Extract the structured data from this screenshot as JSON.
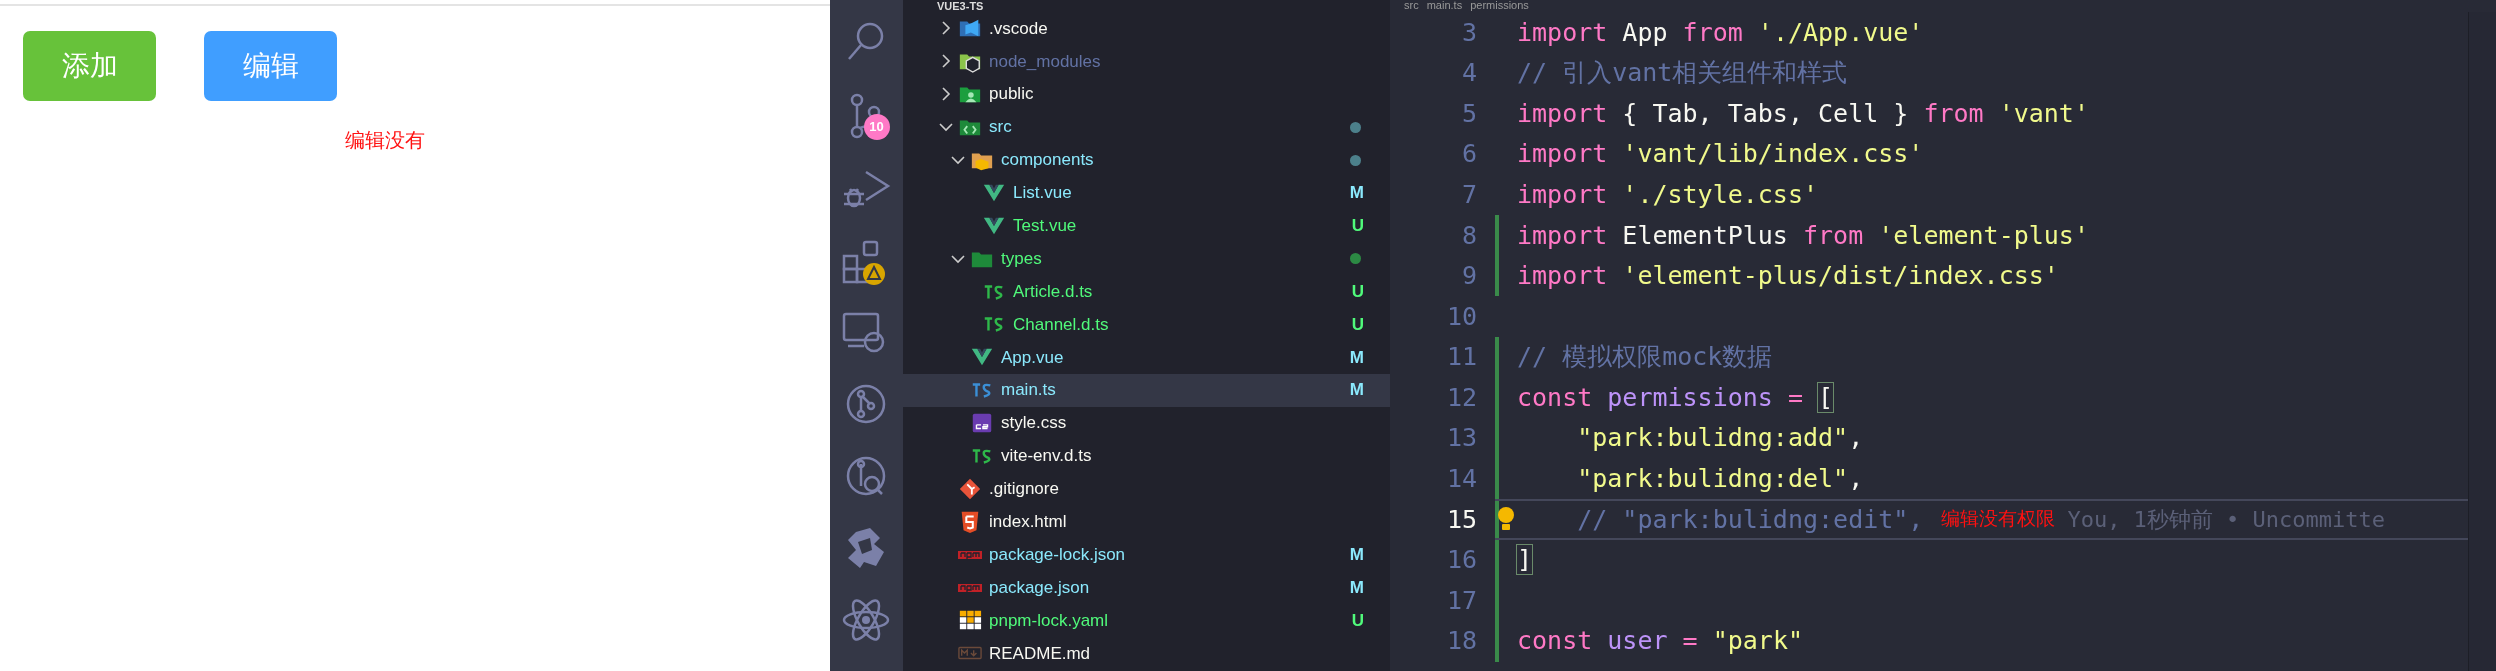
{
  "page": {
    "buttons": [
      {
        "label": "添加",
        "kind": "success"
      },
      {
        "label": "编辑",
        "kind": "primary"
      }
    ],
    "message": "编辑没有"
  },
  "activity_bar": {
    "source_control_badge": "10"
  },
  "explorer": {
    "title": "VUE3-TS",
    "tree": [
      {
        "name": ".vscode",
        "kind": "folder-vscode",
        "expanded": false,
        "color": "#f8f8f2",
        "dot": false,
        "selected": false
      },
      {
        "name": "node_modules",
        "kind": "folder-node",
        "expanded": false,
        "color": "#6272a4",
        "dot": false,
        "selected": false
      },
      {
        "name": "public",
        "kind": "folder-public",
        "expanded": false,
        "color": "#f8f8f2",
        "dot": false,
        "selected": false
      },
      {
        "name": "src",
        "kind": "folder-src",
        "expanded": true,
        "color": "#8be9fd",
        "dot": true,
        "selected": false,
        "children": [
          {
            "name": "components",
            "kind": "folder-components",
            "expanded": true,
            "color": "#8be9fd",
            "dot": true,
            "selected": false,
            "children": [
              {
                "name": "List.vue",
                "kind": "vue",
                "color": "#8be9fd",
                "badge": "M",
                "selected": false
              },
              {
                "name": "Test.vue",
                "kind": "vue",
                "color": "#50fa7b",
                "badge": "U",
                "selected": false
              }
            ]
          },
          {
            "name": "types",
            "kind": "folder-types",
            "expanded": true,
            "color": "#50fa7b",
            "dot": true,
            "selected": false,
            "children": [
              {
                "name": "Article.d.ts",
                "kind": "ts-def",
                "color": "#50fa7b",
                "badge": "U",
                "selected": false
              },
              {
                "name": "Channel.d.ts",
                "kind": "ts-def",
                "color": "#50fa7b",
                "badge": "U",
                "selected": false
              }
            ]
          },
          {
            "name": "App.vue",
            "kind": "vue",
            "color": "#8be9fd",
            "badge": "M",
            "selected": false
          },
          {
            "name": "main.ts",
            "kind": "ts",
            "color": "#8be9fd",
            "badge": "M",
            "selected": true
          },
          {
            "name": "style.css",
            "kind": "css",
            "color": "#f8f8f2",
            "selected": false
          },
          {
            "name": "vite-env.d.ts",
            "kind": "ts-def",
            "color": "#f8f8f2",
            "selected": false
          }
        ]
      },
      {
        "name": ".gitignore",
        "kind": "git",
        "color": "#f8f8f2",
        "selected": false
      },
      {
        "name": "index.html",
        "kind": "html",
        "color": "#f8f8f2",
        "selected": false
      },
      {
        "name": "package-lock.json",
        "kind": "npm",
        "color": "#8be9fd",
        "badge": "M",
        "selected": false
      },
      {
        "name": "package.json",
        "kind": "npm",
        "color": "#8be9fd",
        "badge": "M",
        "selected": false
      },
      {
        "name": "pnpm-lock.yaml",
        "kind": "yaml",
        "color": "#50fa7b",
        "badge": "U",
        "selected": false
      },
      {
        "name": "README.md",
        "kind": "md",
        "color": "#f8f8f2",
        "selected": false
      }
    ]
  },
  "editor": {
    "breadcrumb": [
      "src",
      "main.ts",
      "permissions"
    ],
    "lines": [
      {
        "number": "3",
        "added": false,
        "current": false,
        "tokens": [
          {
            "t": "import ",
            "kind": "keyword"
          },
          {
            "t": "App ",
            "kind": "plain"
          },
          {
            "t": "from ",
            "kind": "keyword"
          },
          {
            "t": "'./App.vue'",
            "kind": "string"
          }
        ]
      },
      {
        "number": "4",
        "added": false,
        "current": false,
        "tokens": [
          {
            "t": "// 引入vant相关组件和样式",
            "kind": "comment"
          }
        ]
      },
      {
        "number": "5",
        "added": false,
        "current": false,
        "tokens": [
          {
            "t": "import ",
            "kind": "keyword"
          },
          {
            "t": "{ Tab, Tabs, Cell } ",
            "kind": "plain"
          },
          {
            "t": "from ",
            "kind": "keyword"
          },
          {
            "t": "'vant'",
            "kind": "string"
          }
        ]
      },
      {
        "number": "6",
        "added": false,
        "current": false,
        "tokens": [
          {
            "t": "import ",
            "kind": "keyword"
          },
          {
            "t": "'vant/lib/index.css'",
            "kind": "string"
          }
        ]
      },
      {
        "number": "7",
        "added": false,
        "current": false,
        "tokens": [
          {
            "t": "import ",
            "kind": "keyword"
          },
          {
            "t": "'./style.css'",
            "kind": "string"
          }
        ]
      },
      {
        "number": "8",
        "added": true,
        "current": false,
        "tokens": [
          {
            "t": "import ",
            "kind": "keyword"
          },
          {
            "t": "ElementPlus ",
            "kind": "plain"
          },
          {
            "t": "from ",
            "kind": "keyword"
          },
          {
            "t": "'element-plus'",
            "kind": "string"
          }
        ]
      },
      {
        "number": "9",
        "added": true,
        "current": false,
        "tokens": [
          {
            "t": "import ",
            "kind": "keyword"
          },
          {
            "t": "'element-plus/dist/index.css'",
            "kind": "string"
          }
        ]
      },
      {
        "number": "10",
        "added": false,
        "current": false
      },
      {
        "number": "11",
        "added": true,
        "current": false,
        "tokens": [
          {
            "t": "// 模拟权限mock数据",
            "kind": "comment"
          }
        ]
      },
      {
        "number": "12",
        "added": true,
        "current": false,
        "tokens": [
          {
            "t": "const ",
            "kind": "keyword"
          },
          {
            "t": "permissions ",
            "kind": "variable"
          },
          {
            "t": "= ",
            "kind": "keyword"
          },
          {
            "t": "[",
            "kind": "bracket-match"
          }
        ]
      },
      {
        "number": "13",
        "added": true,
        "current": false,
        "tokens": [
          {
            "t": "    \"park:bulidng:add\"",
            "kind": "string"
          },
          {
            "t": ",",
            "kind": "plain"
          }
        ]
      },
      {
        "number": "14",
        "added": true,
        "current": false,
        "tokens": [
          {
            "t": "    \"park:bulidng:del\"",
            "kind": "string"
          },
          {
            "t": ",",
            "kind": "plain"
          }
        ]
      },
      {
        "number": "15",
        "added": true,
        "current": true,
        "tokens": [
          {
            "t": "    // \"park:bulidng:edit\",",
            "kind": "comment"
          }
        ],
        "annotation": "编辑没有权限",
        "blame": "You, 1秒钟前 • Uncommitte"
      },
      {
        "number": "16",
        "added": true,
        "current": false,
        "tokens": [
          {
            "t": "]",
            "kind": "bracket-match"
          }
        ]
      },
      {
        "number": "17",
        "added": true,
        "current": false
      },
      {
        "number": "18",
        "added": true,
        "current": false,
        "tokens": [
          {
            "t": "const ",
            "kind": "keyword"
          },
          {
            "t": "user ",
            "kind": "variable"
          },
          {
            "t": "= ",
            "kind": "keyword"
          },
          {
            "t": "\"park\"",
            "kind": "string"
          }
        ]
      }
    ]
  }
}
